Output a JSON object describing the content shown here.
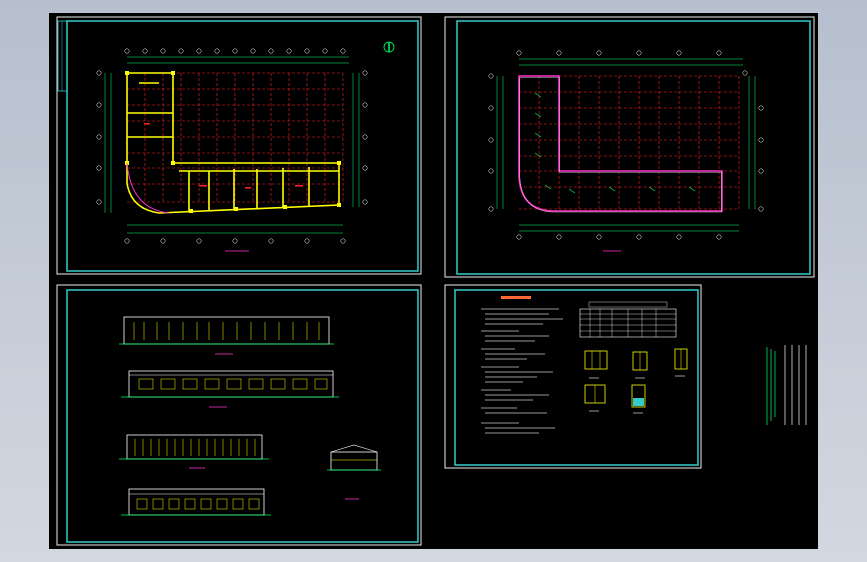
{
  "app": {
    "background": "#c3cad6"
  },
  "colors": {
    "canvas": "#000000",
    "sheet_border": "#33cccc",
    "grid": "#ff2222",
    "wall": "#ffff00",
    "dimension": "#00ff66",
    "magenta": "#ff33cc",
    "text": "#ffffff"
  },
  "sheets": [
    {
      "id": "plan-1",
      "kind": "floor-plan"
    },
    {
      "id": "plan-2",
      "kind": "roof-plan"
    },
    {
      "id": "elevations",
      "kind": "elevations"
    },
    {
      "id": "notes",
      "kind": "design-notes"
    }
  ],
  "icons": {
    "north_arrow": "north-arrow-icon"
  }
}
